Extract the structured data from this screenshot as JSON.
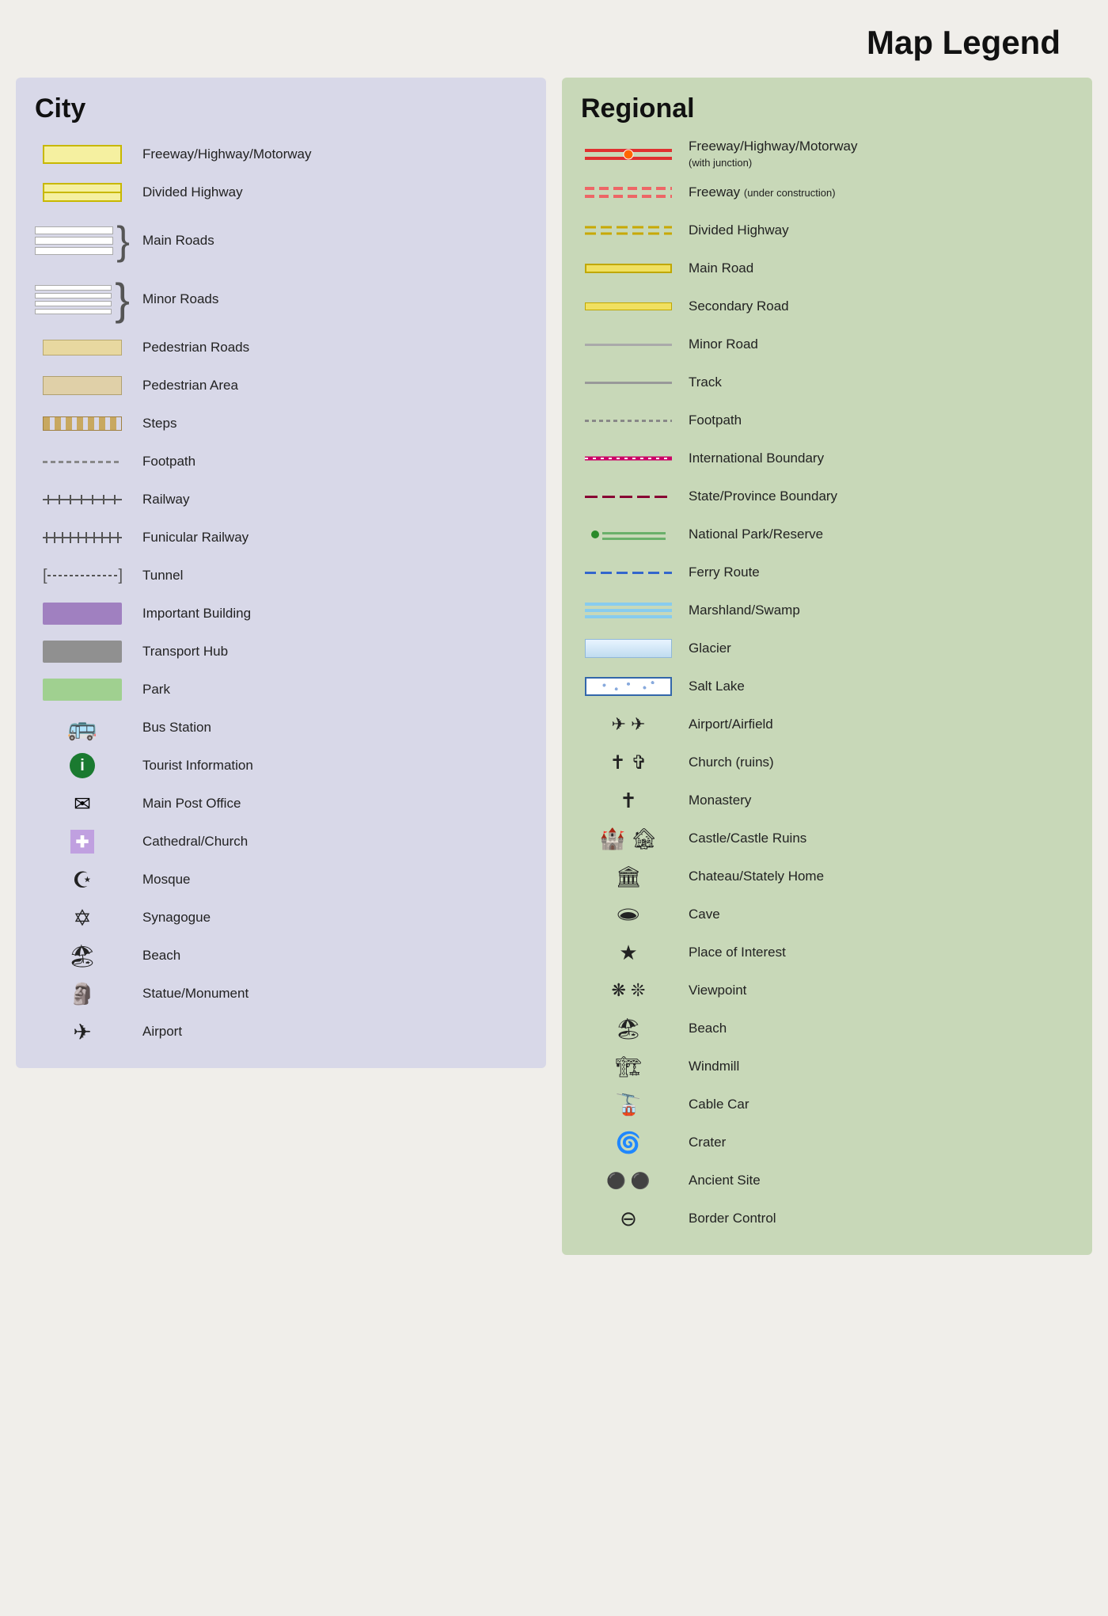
{
  "page": {
    "title": "Map Legend"
  },
  "city": {
    "heading": "City",
    "items": [
      {
        "id": "freeway",
        "label": "Freeway/Highway/Motorway"
      },
      {
        "id": "divided-hwy",
        "label": "Divided Highway"
      },
      {
        "id": "main-roads",
        "label": "Main Roads"
      },
      {
        "id": "minor-roads",
        "label": "Minor Roads"
      },
      {
        "id": "pedestrian-roads",
        "label": "Pedestrian Roads"
      },
      {
        "id": "pedestrian-area",
        "label": "Pedestrian Area"
      },
      {
        "id": "steps",
        "label": "Steps"
      },
      {
        "id": "footpath",
        "label": "Footpath"
      },
      {
        "id": "railway",
        "label": "Railway"
      },
      {
        "id": "funicular",
        "label": "Funicular Railway"
      },
      {
        "id": "tunnel",
        "label": "Tunnel"
      },
      {
        "id": "important-building",
        "label": "Important Building"
      },
      {
        "id": "transport-hub",
        "label": "Transport Hub"
      },
      {
        "id": "park",
        "label": "Park"
      },
      {
        "id": "bus-station",
        "label": "Bus Station"
      },
      {
        "id": "tourist-info",
        "label": "Tourist Information"
      },
      {
        "id": "post-office",
        "label": "Main Post Office"
      },
      {
        "id": "cathedral",
        "label": "Cathedral/Church"
      },
      {
        "id": "mosque",
        "label": "Mosque"
      },
      {
        "id": "synagogue",
        "label": "Synagogue"
      },
      {
        "id": "beach",
        "label": "Beach"
      },
      {
        "id": "statue",
        "label": "Statue/Monument"
      },
      {
        "id": "airport",
        "label": "Airport"
      }
    ]
  },
  "regional": {
    "heading": "Regional",
    "items": [
      {
        "id": "reg-freeway",
        "label": "Freeway/Highway/Motorway",
        "sublabel": "(with junction)"
      },
      {
        "id": "reg-freeway-const",
        "label": "Freeway",
        "sublabel": "(under construction)"
      },
      {
        "id": "reg-divided",
        "label": "Divided Highway"
      },
      {
        "id": "reg-main-road",
        "label": "Main Road"
      },
      {
        "id": "reg-secondary",
        "label": "Secondary Road"
      },
      {
        "id": "reg-minor",
        "label": "Minor Road"
      },
      {
        "id": "reg-track",
        "label": "Track"
      },
      {
        "id": "reg-footpath",
        "label": "Footpath"
      },
      {
        "id": "reg-intl",
        "label": "International Boundary"
      },
      {
        "id": "reg-state",
        "label": "State/Province Boundary"
      },
      {
        "id": "reg-natpark",
        "label": "National Park/Reserve"
      },
      {
        "id": "reg-ferry",
        "label": "Ferry Route"
      },
      {
        "id": "reg-marshland",
        "label": "Marshland/Swamp"
      },
      {
        "id": "reg-glacier",
        "label": "Glacier"
      },
      {
        "id": "reg-saltlake",
        "label": "Salt Lake"
      },
      {
        "id": "reg-airport",
        "label": "Airport/Airfield"
      },
      {
        "id": "reg-church",
        "label": "Church (ruins)"
      },
      {
        "id": "reg-monastery",
        "label": "Monastery"
      },
      {
        "id": "reg-castle",
        "label": "Castle/Castle Ruins"
      },
      {
        "id": "reg-chateau",
        "label": "Chateau/Stately Home"
      },
      {
        "id": "reg-cave",
        "label": "Cave"
      },
      {
        "id": "reg-interest",
        "label": "Place of Interest"
      },
      {
        "id": "reg-viewpoint",
        "label": "Viewpoint"
      },
      {
        "id": "reg-beach",
        "label": "Beach"
      },
      {
        "id": "reg-windmill",
        "label": "Windmill"
      },
      {
        "id": "reg-cablecar",
        "label": "Cable Car"
      },
      {
        "id": "reg-crater",
        "label": "Crater"
      },
      {
        "id": "reg-ancient",
        "label": "Ancient Site"
      },
      {
        "id": "reg-border",
        "label": "Border Control"
      }
    ]
  }
}
